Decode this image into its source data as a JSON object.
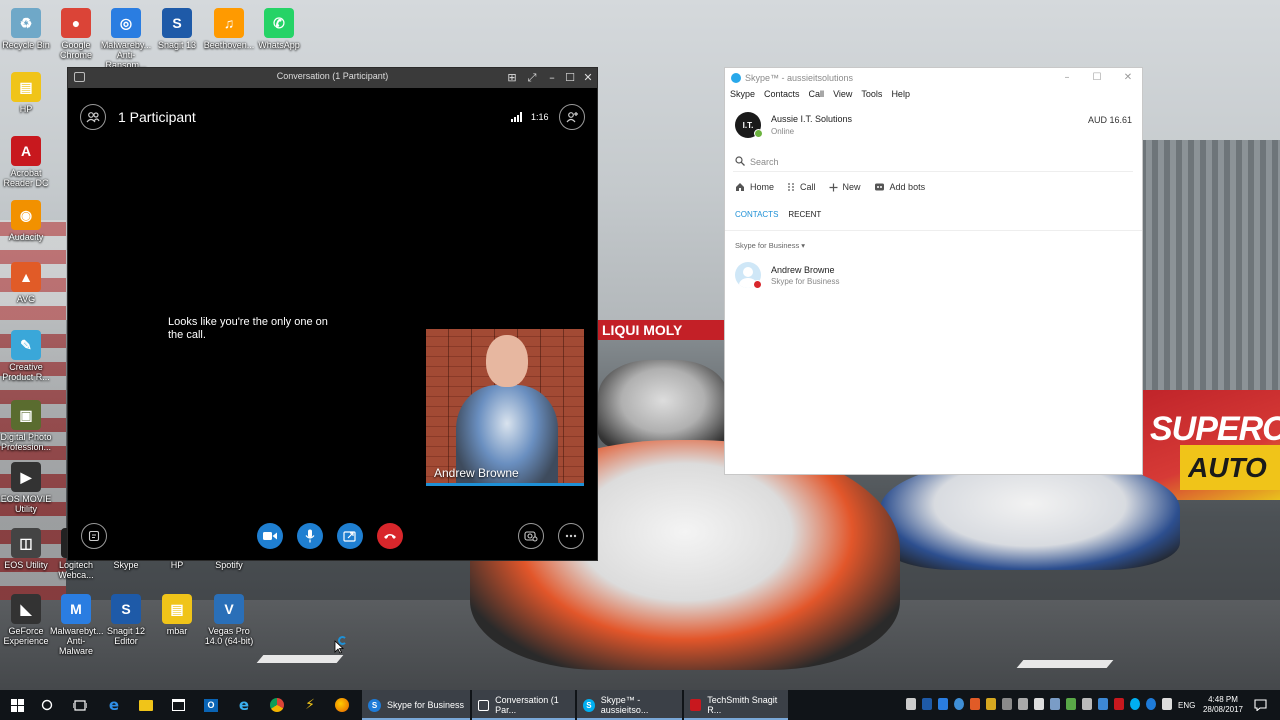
{
  "desktop": {
    "icons": [
      {
        "label": "Recycle Bin",
        "color": "#6fa8c8",
        "glyph": "♻"
      },
      {
        "label": "Google Chrome",
        "color": "#db4437",
        "glyph": "●"
      },
      {
        "label": "Malwareby... Anti-Ransom...",
        "color": "#2a7de1",
        "glyph": "◎"
      },
      {
        "label": "Snagit 13",
        "color": "#1e5aa8",
        "glyph": "S"
      },
      {
        "label": "Beethoven...",
        "color": "#ff9a00",
        "glyph": "♫"
      },
      {
        "label": "WhatsApp",
        "color": "#25d366",
        "glyph": "✆"
      },
      {
        "label": "HP",
        "color": "#f0c419",
        "glyph": "▤"
      },
      {
        "label": "Acrobat Reader DC",
        "color": "#c8181e",
        "glyph": "A"
      },
      {
        "label": "Audacity",
        "color": "#f29100",
        "glyph": "◉"
      },
      {
        "label": "AVG",
        "color": "#e15b27",
        "glyph": "▲"
      },
      {
        "label": "Creative Product R...",
        "color": "#3aa7d9",
        "glyph": "✎"
      },
      {
        "label": "Digital Photo Profession...",
        "color": "#5a6c2f",
        "glyph": "▣"
      },
      {
        "label": "EOS MOVIE Utility",
        "color": "#333333",
        "glyph": "▶"
      },
      {
        "label": "EOS Utility",
        "color": "#444444",
        "glyph": "◫"
      },
      {
        "label": "Logitech Webca...",
        "color": "#222222",
        "glyph": "◍"
      },
      {
        "label": "Skype",
        "color": "#00aff0",
        "glyph": "S"
      },
      {
        "label": "HP",
        "color": "#0096d6",
        "glyph": "hp"
      },
      {
        "label": "Spotify",
        "color": "#1db954",
        "glyph": "≋"
      },
      {
        "label": "GeForce Experience",
        "color": "#333333",
        "glyph": "◣"
      },
      {
        "label": "Malwarebyt... Anti-Malware",
        "color": "#2a7de1",
        "glyph": "M"
      },
      {
        "label": "Snagit 12 Editor",
        "color": "#1e5aa8",
        "glyph": "S"
      },
      {
        "label": "mbar",
        "color": "#f0c419",
        "glyph": "▤"
      },
      {
        "label": "Vegas Pro 14.0 (64-bit)",
        "color": "#2a6fb8",
        "glyph": "V"
      }
    ],
    "wallpaper": {
      "banner_text": "SUPERC",
      "banner_text2": "AUTO",
      "liqui": "LIQUI MOLY"
    }
  },
  "conversation": {
    "window_title": "Conversation (1 Participant)",
    "participants_label": "1 Participant",
    "timer": "1:16",
    "alone_message": "Looks like you're the only one on the call.",
    "video_name": "Andrew Browne",
    "colors": {
      "call_blue": "#1f7fd1",
      "hangup_red": "#d8262b"
    }
  },
  "skype": {
    "window_title": "Skype™ - aussieitsolutions",
    "menu": [
      "Skype",
      "Contacts",
      "Call",
      "View",
      "Tools",
      "Help"
    ],
    "profile": {
      "avatar_text": "I.T.",
      "name": "Aussie I.T. Solutions",
      "status": "Online",
      "credit": "AUD 16.61"
    },
    "search_placeholder": "Search",
    "actions": [
      {
        "label": "Home",
        "icon": "home-icon"
      },
      {
        "label": "Call",
        "icon": "dialpad-icon"
      },
      {
        "label": "New",
        "icon": "plus-icon"
      },
      {
        "label": "Add bots",
        "icon": "bot-icon"
      }
    ],
    "tabs": {
      "contacts": "CONTACTS",
      "recent": "RECENT"
    },
    "group_label": "Skype for Business ▾",
    "contact": {
      "name": "Andrew Browne",
      "subtitle": "Skype for Business"
    }
  },
  "taskbar": {
    "tasks": [
      {
        "label": "Skype for Business"
      },
      {
        "label": "Conversation (1 Par..."
      },
      {
        "label": "Skype™ - aussieitso..."
      },
      {
        "label": "TechSmith Snagit R..."
      }
    ],
    "language": "ENG",
    "time": "4:48 PM",
    "date": "28/08/2017"
  }
}
